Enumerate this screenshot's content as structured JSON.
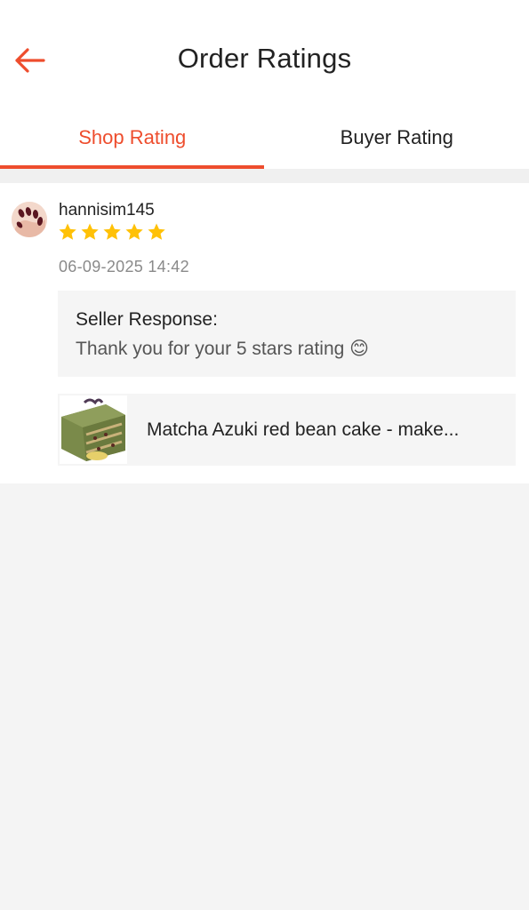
{
  "header": {
    "title": "Order Ratings",
    "back_icon": "arrow-left-icon",
    "accent_color": "#ee4d2d"
  },
  "tabs": [
    {
      "label": "Shop Rating",
      "active": true
    },
    {
      "label": "Buyer Rating",
      "active": false
    }
  ],
  "review": {
    "username": "hannisim145",
    "avatar_icon": "user-avatar",
    "rating": 5,
    "rating_max": 5,
    "star_color": "#ffc107",
    "timestamp": "06-09-2025 14:42",
    "seller_response": {
      "label": "Seller Response:",
      "text": "Thank you for your 5 stars rating 😊"
    },
    "product": {
      "name": "Matcha Azuki red bean cake - make..."
    }
  }
}
